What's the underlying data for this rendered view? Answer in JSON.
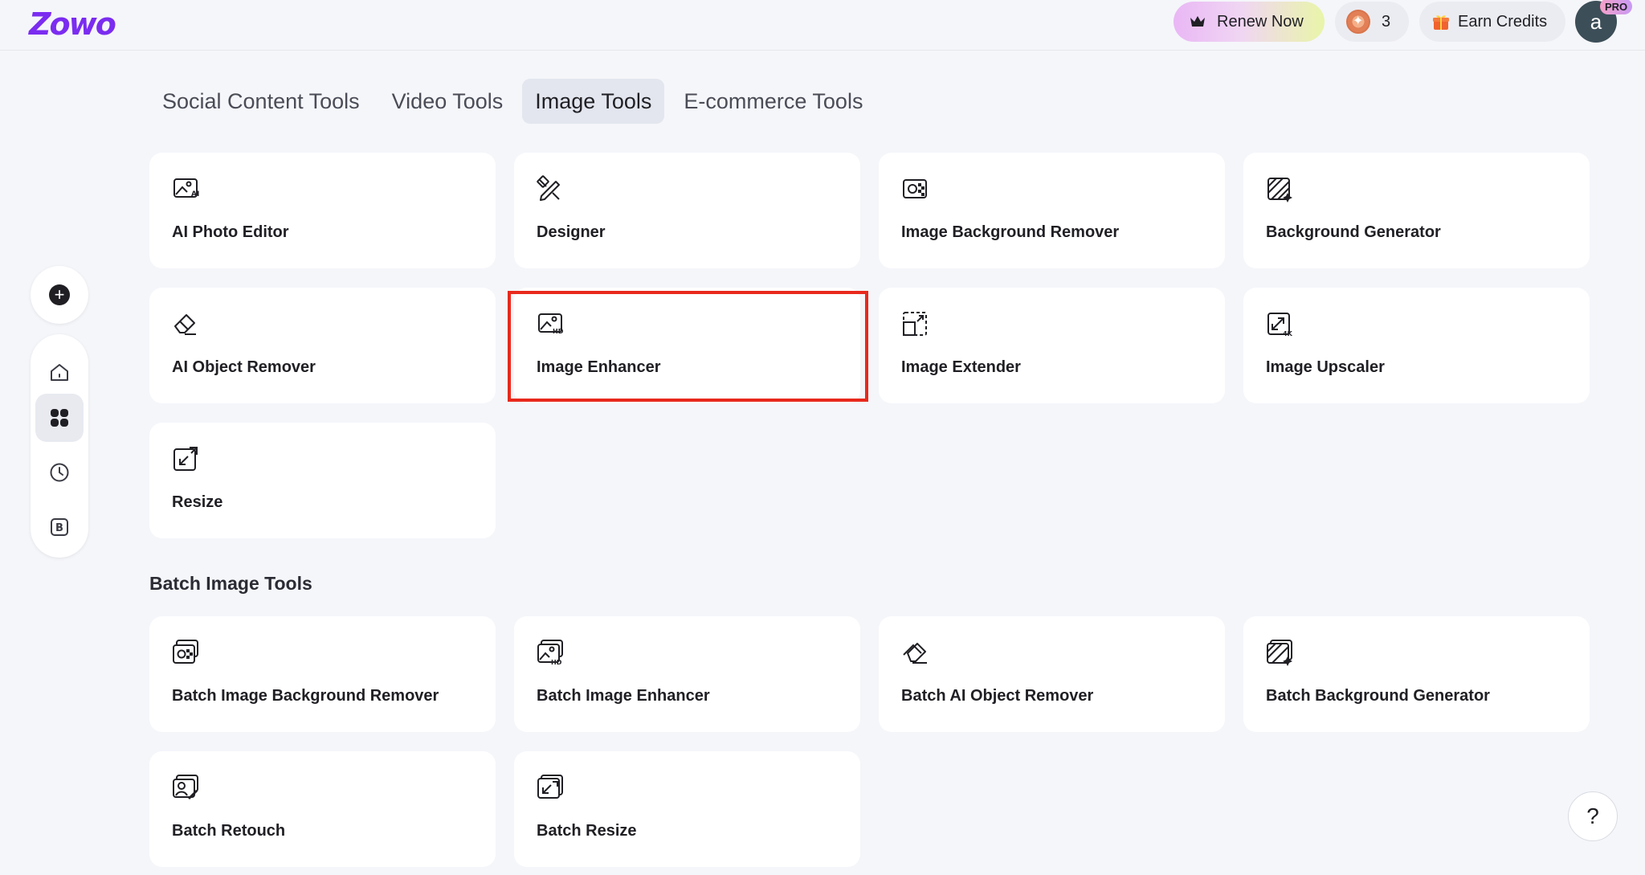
{
  "app": {
    "logo": "Zowo"
  },
  "header": {
    "renew_label": "Renew Now",
    "credits_count": "3",
    "earn_label": "Earn Credits",
    "avatar_letter": "a",
    "pro_badge": "PRO"
  },
  "tabs": [
    {
      "label": "Social Content Tools",
      "active": false
    },
    {
      "label": "Video Tools",
      "active": false
    },
    {
      "label": "Image Tools",
      "active": true
    },
    {
      "label": "E-commerce Tools",
      "active": false
    }
  ],
  "sidebar": {
    "add_icon": "plus-icon",
    "items": [
      {
        "icon": "home-icon"
      },
      {
        "icon": "grid-icon",
        "active": true
      },
      {
        "icon": "clock-icon"
      },
      {
        "icon": "brand-icon"
      }
    ]
  },
  "image_tools": [
    {
      "label": "AI Photo Editor",
      "icon": "ai-photo-icon"
    },
    {
      "label": "Designer",
      "icon": "designer-icon"
    },
    {
      "label": "Image Background Remover",
      "icon": "bg-remover-icon"
    },
    {
      "label": "Background Generator",
      "icon": "bg-generator-icon"
    },
    {
      "label": "AI Object Remover",
      "icon": "eraser-icon"
    },
    {
      "label": "Image Enhancer",
      "icon": "hd-image-icon",
      "highlighted": true
    },
    {
      "label": "Image Extender",
      "icon": "extender-icon"
    },
    {
      "label": "Image Upscaler",
      "icon": "upscaler-4k-icon"
    },
    {
      "label": "Resize",
      "icon": "resize-icon"
    }
  ],
  "batch_section_title": "Batch Image Tools",
  "batch_tools": [
    {
      "label": "Batch Image Background Remover",
      "icon": "batch-bg-remover-icon"
    },
    {
      "label": "Batch Image Enhancer",
      "icon": "batch-hd-icon"
    },
    {
      "label": "Batch AI Object Remover",
      "icon": "batch-eraser-icon"
    },
    {
      "label": "Batch Background Generator",
      "icon": "batch-bg-generator-icon"
    },
    {
      "label": "Batch Retouch",
      "icon": "batch-retouch-icon"
    },
    {
      "label": "Batch Resize",
      "icon": "batch-resize-icon"
    }
  ],
  "help_label": "?",
  "colors": {
    "brand": "#7b2cf0",
    "highlight": "#e8291c",
    "background": "#f5f6fa"
  }
}
